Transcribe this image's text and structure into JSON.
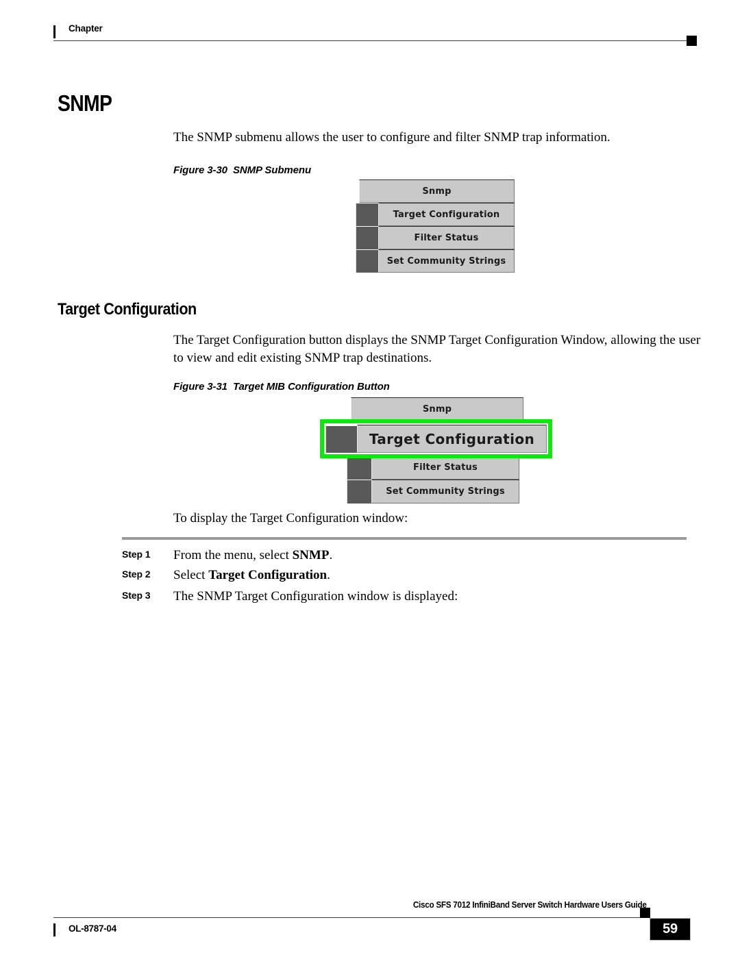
{
  "header": {
    "chapter_label": "Chapter"
  },
  "headings": {
    "h1": "SNMP",
    "h2": "Target Configuration"
  },
  "paragraphs": {
    "intro": "The SNMP submenu allows the user to configure and filter SNMP trap information.",
    "target_config": "The Target Configuration button displays the SNMP Target Configuration Window, allowing the user to view and edit existing SNMP trap destinations.",
    "to_display": "To display the Target Configuration window:"
  },
  "figures": {
    "fig_330": {
      "number": "Figure 3-30",
      "title": "SNMP Submenu",
      "menu": {
        "header_item": "Snmp",
        "items": [
          "Target Configuration",
          "Filter Status",
          "Set Community Strings"
        ]
      }
    },
    "fig_331": {
      "number": "Figure 3-31",
      "title": "Target MIB Configuration Button",
      "menu": {
        "header_item": "Snmp",
        "highlighted_item": "Target Configuration",
        "items": [
          "Filter Status",
          "Set Community Strings"
        ]
      },
      "highlight_color": "#0ee80e"
    }
  },
  "steps": [
    {
      "label": "Step 1",
      "text_before": "From the menu, select ",
      "text_bold": "SNMP",
      "text_after": "."
    },
    {
      "label": "Step 2",
      "text_before": "Select ",
      "text_bold": "Target Configuration",
      "text_after": "."
    },
    {
      "label": "Step 3",
      "text_before": "The SNMP Target Configuration window is displayed:",
      "text_bold": "",
      "text_after": ""
    }
  ],
  "footer": {
    "guide_title": "Cisco SFS 7012 InfiniBand Server Switch Hardware Users Guide",
    "doc_id": "OL-8787-04",
    "page_number": "59"
  }
}
